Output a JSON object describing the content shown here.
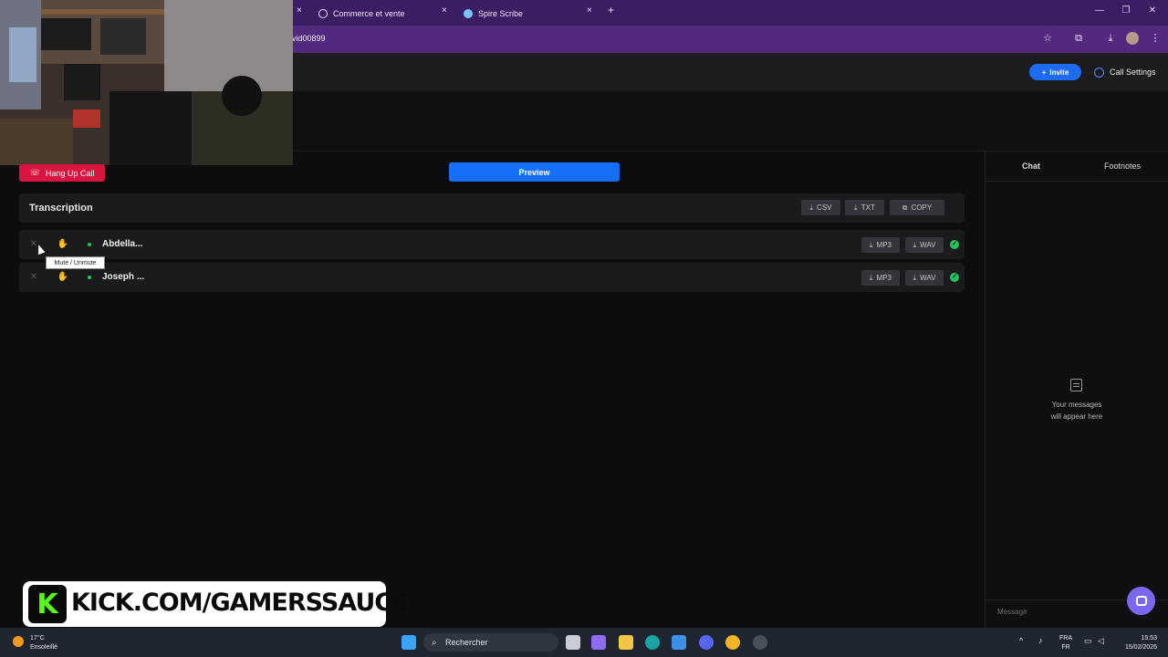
{
  "browser": {
    "tabs": [
      {
        "label": "Commerce et vente"
      },
      {
        "label": "Spire Scribe"
      }
    ],
    "url": "vid00899",
    "tab_close_glyph": "×",
    "new_tab_glyph": "+",
    "window_controls": [
      "—",
      "❐",
      "✕"
    ],
    "toolbar_icons": [
      "star-icon",
      "extensions-icon",
      "download-icon",
      "profile-avatar",
      "menu-icon"
    ]
  },
  "header": {
    "invite_label": "Invite",
    "settings_label": "Call Settings"
  },
  "main": {
    "hangup_label": "Hang Up Call",
    "preview_label": "Preview",
    "transcription": {
      "title": "Transcription",
      "buttons": {
        "csv": "CSV",
        "txt": "TXT",
        "copy": "COPY"
      }
    },
    "participants": [
      {
        "name": "Abdella...",
        "mp3": "MP3",
        "wav": "WAV"
      },
      {
        "name": "Joseph ...",
        "mp3": "MP3",
        "wav": "WAV"
      }
    ],
    "tooltip": "Mute / Unmute"
  },
  "sidebar": {
    "tabs": {
      "chat": "Chat",
      "footnotes": "Footnotes"
    },
    "empty_line1": "Your messages",
    "empty_line2": "will appear here",
    "message_placeholder": "Message"
  },
  "overlay": {
    "kick_logo": "K",
    "kick_text": "KICK.COM/GAMERSSAUCE"
  },
  "taskbar": {
    "weather_temp": "17°C",
    "weather_desc": "Ensoleillé",
    "search_label": "Rechercher",
    "lang_line1": "FRA",
    "lang_line2": "FR",
    "time": "15:53",
    "date": "15/02/2026"
  },
  "colors": {
    "accent": "#1670f7",
    "danger": "#d9143f",
    "online": "#22c55e",
    "tabbar": "#3b1d63",
    "addrbar": "#52297f"
  }
}
